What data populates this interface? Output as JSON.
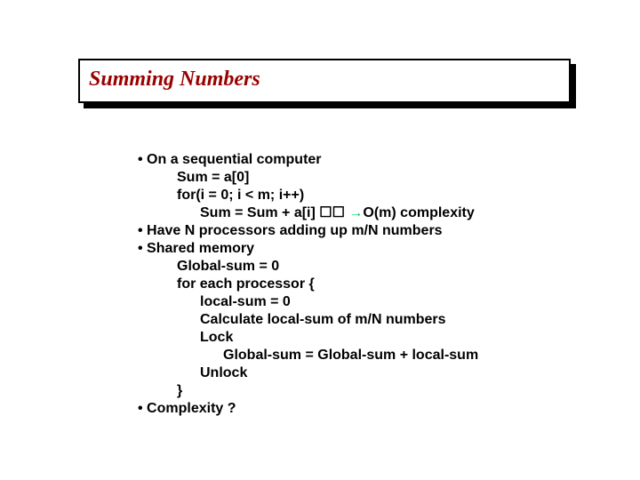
{
  "title": "Summing Numbers",
  "lines": {
    "b1": "• On a sequential computer",
    "l1": "Sum = a[0]",
    "l2": "for(i = 0; i < m; i++)",
    "l3a": "Sum = Sum + a[i] ",
    "l3boxes": "☐☐ ",
    "l3arrow": "→",
    "l3b": "O(m) complexity",
    "b2": "• Have N processors adding up m/N numbers",
    "b3": "• Shared memory",
    "l4": "Global-sum = 0",
    "l5": "for each processor {",
    "l6": "local-sum = 0",
    "l7": "Calculate local-sum of m/N numbers",
    "l8": "Lock",
    "l9": "Global-sum = Global-sum + local-sum",
    "l10": "Unlock",
    "l11": "}",
    "b4": "• Complexity ?"
  }
}
